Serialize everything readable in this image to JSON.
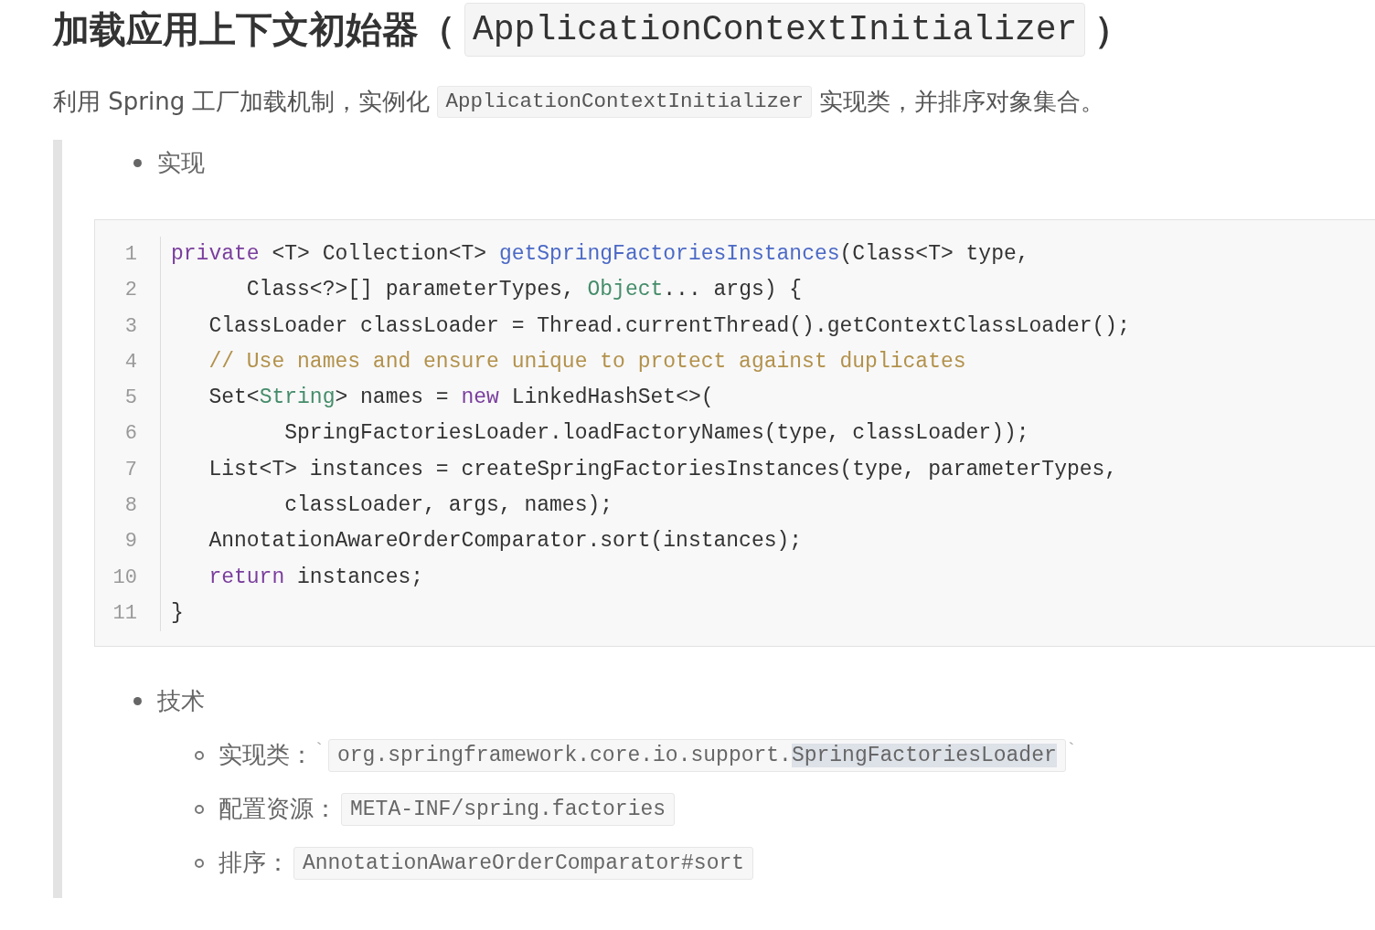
{
  "heading": {
    "text": "加载应用上下文初始器（",
    "code": "ApplicationContextInitializer",
    "suffix": "）"
  },
  "intro": {
    "before": "利用 Spring 工厂加载机制，实例化",
    "code": "ApplicationContextInitializer",
    "after": "实现类，并排序对象集合。"
  },
  "sections": [
    {
      "title": "实现",
      "code_block": {
        "lines": [
          {
            "number": "1",
            "tokens": [
              {
                "kind": "keyword",
                "text": "private"
              },
              {
                "kind": "plain",
                "text": " <T> Collection<T> "
              },
              {
                "kind": "function",
                "text": "getSpringFactoriesInstances"
              },
              {
                "kind": "plain",
                "text": "(Class<T> type,"
              }
            ]
          },
          {
            "number": "2",
            "tokens": [
              {
                "kind": "plain",
                "text": "      Class<?>[] parameterTypes, "
              },
              {
                "kind": "type",
                "text": "Object"
              },
              {
                "kind": "plain",
                "text": "... args) {"
              }
            ]
          },
          {
            "number": "3",
            "tokens": [
              {
                "kind": "plain",
                "text": "   ClassLoader classLoader = Thread.currentThread().getContextClassLoader();"
              }
            ]
          },
          {
            "number": "4",
            "tokens": [
              {
                "kind": "comment",
                "text": "   // Use names and ensure unique to protect against duplicates"
              }
            ]
          },
          {
            "number": "5",
            "tokens": [
              {
                "kind": "plain",
                "text": "   Set<"
              },
              {
                "kind": "type",
                "text": "String"
              },
              {
                "kind": "plain",
                "text": "> names = "
              },
              {
                "kind": "keyword",
                "text": "new"
              },
              {
                "kind": "plain",
                "text": " LinkedHashSet<>("
              }
            ]
          },
          {
            "number": "6",
            "tokens": [
              {
                "kind": "plain",
                "text": "         SpringFactoriesLoader.loadFactoryNames(type, classLoader));"
              }
            ]
          },
          {
            "number": "7",
            "tokens": [
              {
                "kind": "plain",
                "text": "   List<T> instances = createSpringFactoriesInstances(type, parameterTypes,"
              }
            ]
          },
          {
            "number": "8",
            "tokens": [
              {
                "kind": "plain",
                "text": "         classLoader, args, names);"
              }
            ]
          },
          {
            "number": "9",
            "tokens": [
              {
                "kind": "plain",
                "text": "   AnnotationAwareOrderComparator.sort(instances);"
              }
            ]
          },
          {
            "number": "10",
            "tokens": [
              {
                "kind": "keyword",
                "text": "   return"
              },
              {
                "kind": "plain",
                "text": " instances;"
              }
            ]
          },
          {
            "number": "11",
            "tokens": [
              {
                "kind": "plain",
                "text": "}"
              }
            ]
          }
        ]
      }
    },
    {
      "title": "技术",
      "items": [
        {
          "label": "实现类：",
          "prefix": "`",
          "code_segments": [
            {
              "text": "org.springframework.core.io.support.",
              "selected": false
            },
            {
              "text": "SpringFactoriesLoader",
              "selected": true
            }
          ],
          "suffix": "`"
        },
        {
          "label": "配置资源：",
          "code_segments": [
            {
              "text": "META-INF/spring.factories",
              "selected": false
            }
          ]
        },
        {
          "label": "排序：",
          "code_segments": [
            {
              "text": "AnnotationAwareOrderComparator#sort",
              "selected": false
            }
          ]
        }
      ]
    }
  ]
}
